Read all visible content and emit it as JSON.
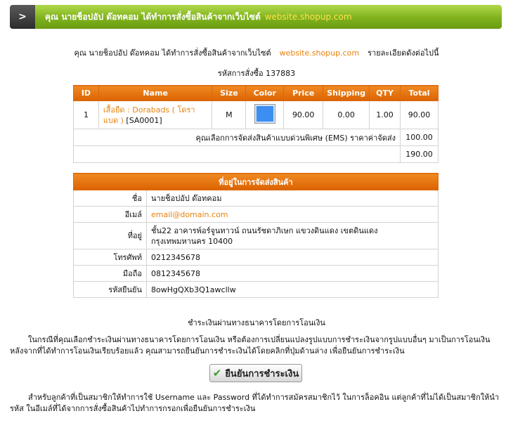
{
  "header": {
    "arrow": ">",
    "title": "คุณ นายช็อปอัป ด๊อทคอม ได้ทำการสั่งซื้อสินค้าจากเว็บไซต์",
    "site": "website.shopup.com"
  },
  "intro": {
    "prefix": "คุณ นายช็อปอัป ด๊อทคอม ได้ทำการสั่งซื้อสินค้าจากเว็บไซต์",
    "site": "website.shopup.com",
    "suffix": "รายละเอียดดังต่อไปนี้"
  },
  "order_code": "รหัสการสั่งซื้อ 137883",
  "order_table": {
    "headers": [
      "ID",
      "Name",
      "Size",
      "Color",
      "Price",
      "Shipping",
      "QTY",
      "Total"
    ],
    "rows": [
      {
        "id": "1",
        "product": "เสื้อยืด : Dorabads ( โดราแบด )",
        "sku": "[SA0001]",
        "size": "M",
        "color": "#3c8ff0",
        "price": "90.00",
        "shipping": "0.00",
        "qty": "1.00",
        "total": "90.00"
      }
    ],
    "shipping_note": "คุณเลือกการจัดส่งสินค้าแบบด่วนพิเศษ (EMS) ราคาค่าจัดส่ง",
    "shipping_cost": "100.00",
    "grand_total": "190.00"
  },
  "ship_table": {
    "title": "ที่อยู่ในการจัดส่งสินค้า",
    "rows": [
      {
        "label": "ชื่อ",
        "value": "นายช็อปอัป ด๊อทคอม"
      },
      {
        "label": "อีเมล์",
        "value": "email@domain.com"
      },
      {
        "label": "ที่อยู่",
        "value": "ชั้น22 อาคารพ์อร์จูนทาวน์ ถนนรัชดาภิเษก แขวงดินแดง เขตดินแดง กรุงเทพมหานคร 10400"
      },
      {
        "label": "โทรศัพท์",
        "value": "0212345678"
      },
      {
        "label": "มือถือ",
        "value": "0812345678"
      },
      {
        "label": "รหัสยืนยัน",
        "value": "8owHgQXb3Q1awcllw"
      }
    ]
  },
  "payment": {
    "title": "ชำระเงินผ่านทางธนาคารโดยการโอนเงิน",
    "para1": "ในกรณีที่คุณเลือกชำระเงินผ่านทางธนาคารโดยการโอนเงิน หรือต้องการเปลี่ยนแปลงรูปแบบการชำระเงินจากรูปแบบอื่นๆ มาเป็นการโอนเงิน หลังจากที่ได้ทำการโอนเงินเรียบร้อยแล้ว คุณสามารถยืนยันการชำระเงินได้โดยคลิกที่ปุ่มด้านล่าง เพื่อยืนยันการชำระเงิน",
    "button_label": "ยืนยันการชำระเงิน",
    "para2": "สำหรับลูกค้าที่เป็นสมาชิกให้ทำการใช้ Username และ Password ที่ได้ทำการสมัครสมาชิกไว้ ในการล็อคอิน แต่ลูกค้าที่ไม่ได้เป็นสมาชิกให้นำรหัส ในอีเมล์ที่ได้จากการสั่งซื้อสินค้าไปทำการกรอกเพื่อยืนยันการชำระเงิน"
  }
}
